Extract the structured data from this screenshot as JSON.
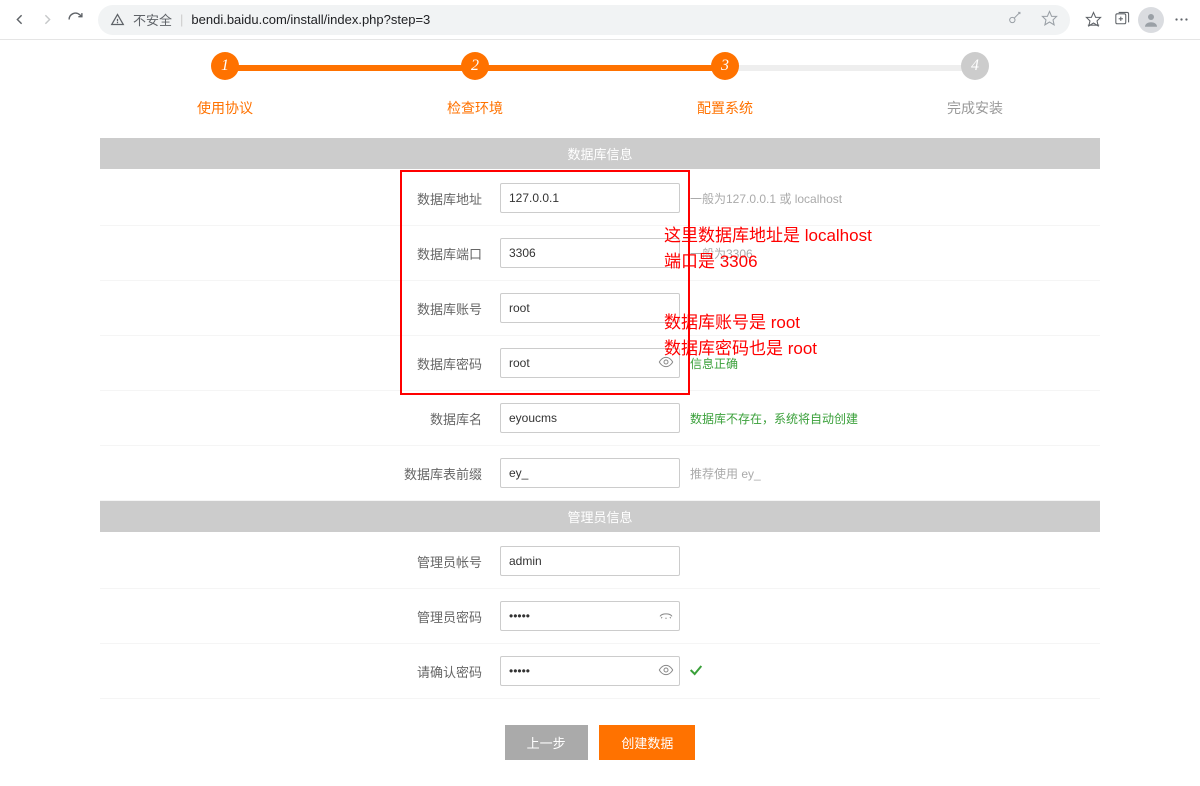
{
  "chrome": {
    "insecure": "不安全",
    "url": "bendi.baidu.com/install/index.php?step=3"
  },
  "steps": [
    {
      "num": "1",
      "label": "使用协议",
      "active": true
    },
    {
      "num": "2",
      "label": "检查环境",
      "active": true
    },
    {
      "num": "3",
      "label": "配置系统",
      "active": true
    },
    {
      "num": "4",
      "label": "完成安装",
      "active": false
    }
  ],
  "sections": {
    "db": "数据库信息",
    "admin": "管理员信息"
  },
  "db": {
    "host_label": "数据库地址",
    "host_value": "127.0.0.1",
    "host_hint": "一般为127.0.0.1 或 localhost",
    "port_label": "数据库端口",
    "port_value": "3306",
    "port_hint": "一般为3306",
    "user_label": "数据库账号",
    "user_value": "root",
    "pwd_label": "数据库密码",
    "pwd_value": "root",
    "pwd_hint": "信息正确",
    "name_label": "数据库名",
    "name_value": "eyoucms",
    "name_hint": "数据库不存在，系统将自动创建",
    "prefix_label": "数据库表前缀",
    "prefix_value": "ey_",
    "prefix_hint": "推荐使用 ey_"
  },
  "admin": {
    "user_label": "管理员帐号",
    "user_value": "admin",
    "pwd_label": "管理员密码",
    "pwd_value": "•••••",
    "pwd2_label": "请确认密码",
    "pwd2_value": "•••••"
  },
  "buttons": {
    "prev": "上一步",
    "next": "创建数据"
  },
  "anno": {
    "line1": "这里数据库地址是 localhost",
    "line2": "端口是 3306",
    "line3": "数据库账号是 root",
    "line4": "数据库密码也是 root"
  }
}
